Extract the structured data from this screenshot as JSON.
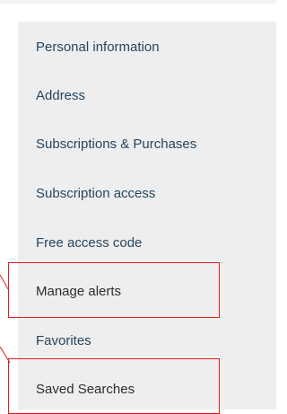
{
  "account_nav": {
    "items": [
      {
        "label": "Personal information"
      },
      {
        "label": "Address"
      },
      {
        "label": "Subscriptions & Purchases"
      },
      {
        "label": "Subscription access"
      },
      {
        "label": "Free access code"
      },
      {
        "label": "Manage alerts",
        "highlighted": true
      },
      {
        "label": "Favorites"
      },
      {
        "label": "Saved Searches",
        "highlighted": true
      }
    ]
  },
  "colors": {
    "link": "#26465f",
    "active_text": "#2d2d2d",
    "sidebar_bg": "#eeeeee",
    "annotation": "#e01b1b"
  }
}
